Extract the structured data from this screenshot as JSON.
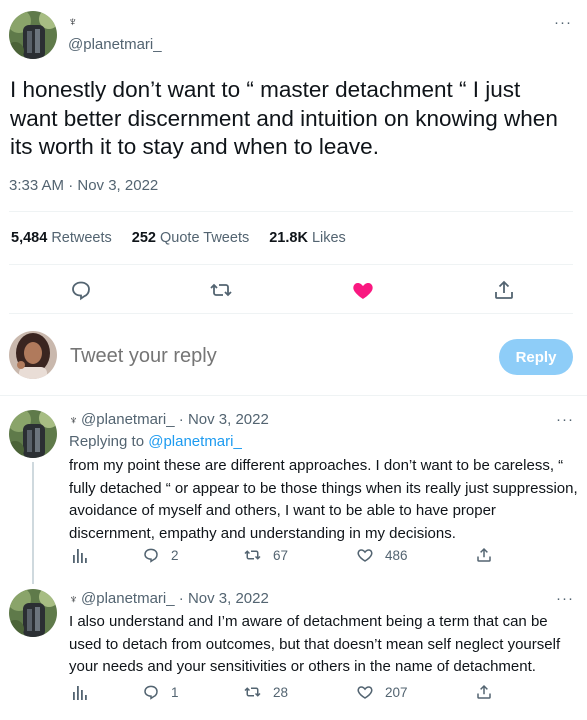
{
  "main_tweet": {
    "badge": "♆",
    "handle": "@planetmari_",
    "more": "···",
    "text": "I honestly don’t want to “ master detachment “ I just want better discernment and intuition on knowing when its worth it to stay and when to leave.",
    "timestamp": "3:33 AM · Nov 3, 2022",
    "stats": {
      "retweets_count": "5,484",
      "retweets_label": "Retweets",
      "quotes_count": "252",
      "quotes_label": "Quote Tweets",
      "likes_count": "21.8K",
      "likes_label": "Likes"
    },
    "actions": [
      "reply-icon",
      "retweet-icon",
      "heart-filled-icon",
      "share-icon"
    ],
    "liked": true
  },
  "compose": {
    "placeholder": "Tweet your reply",
    "reply_button": "Reply"
  },
  "replies": [
    {
      "badge": "♆",
      "handle": "@planetmari_",
      "date": "· Nov 3, 2022",
      "more": "···",
      "replying_prefix": "Replying to ",
      "replying_to": "@planetmari_",
      "text": "from my point these are different approaches. I don’t want to be careless, “ fully detached “ or appear to be those things when its really just suppression,  avoidance of myself and others, I want to be able to have proper discernment, empathy and understanding in my decisions.",
      "replies_count": "2",
      "retweets_count": "67",
      "likes_count": "486"
    },
    {
      "badge": "♆",
      "handle": "@planetmari_",
      "date": "· Nov 3, 2022",
      "more": "···",
      "text": "I also understand and I’m aware of detachment being a term that can be used to detach from outcomes, but that doesn’t mean self neglect yourself your needs and your sensitivities or others in the name of detachment.",
      "replies_count": "1",
      "retweets_count": "28",
      "likes_count": "207"
    }
  ],
  "colors": {
    "accent": "#1d9bf0",
    "like": "#f91880",
    "muted": "#536471",
    "reply_button_disabled": "#8ecdf8"
  }
}
